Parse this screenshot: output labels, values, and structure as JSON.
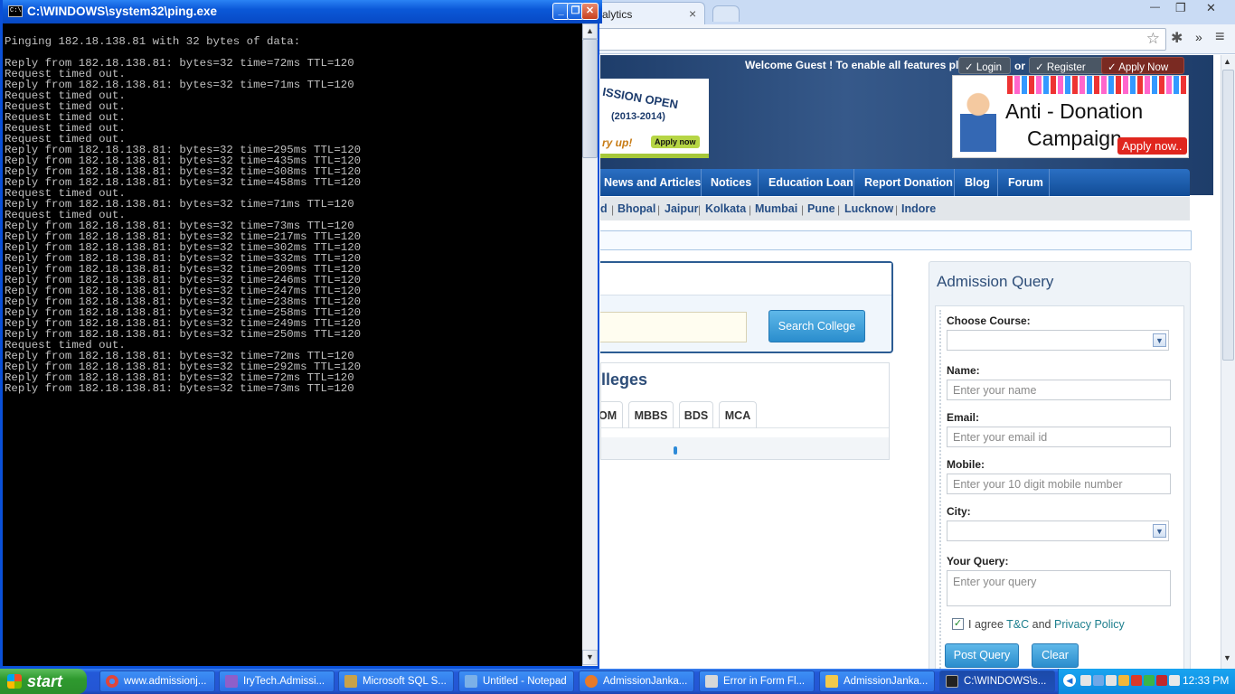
{
  "console": {
    "title": "C:\\WINDOWS\\system32\\ping.exe",
    "output": "Pinging 182.18.138.81 with 32 bytes of data:\n\nReply from 182.18.138.81: bytes=32 time=72ms TTL=120\nRequest timed out.\nReply from 182.18.138.81: bytes=32 time=71ms TTL=120\nRequest timed out.\nRequest timed out.\nRequest timed out.\nRequest timed out.\nRequest timed out.\nReply from 182.18.138.81: bytes=32 time=295ms TTL=120\nReply from 182.18.138.81: bytes=32 time=435ms TTL=120\nReply from 182.18.138.81: bytes=32 time=308ms TTL=120\nReply from 182.18.138.81: bytes=32 time=458ms TTL=120\nRequest timed out.\nReply from 182.18.138.81: bytes=32 time=71ms TTL=120\nRequest timed out.\nReply from 182.18.138.81: bytes=32 time=73ms TTL=120\nReply from 182.18.138.81: bytes=32 time=217ms TTL=120\nReply from 182.18.138.81: bytes=32 time=302ms TTL=120\nReply from 182.18.138.81: bytes=32 time=332ms TTL=120\nReply from 182.18.138.81: bytes=32 time=209ms TTL=120\nReply from 182.18.138.81: bytes=32 time=246ms TTL=120\nReply from 182.18.138.81: bytes=32 time=247ms TTL=120\nReply from 182.18.138.81: bytes=32 time=238ms TTL=120\nReply from 182.18.138.81: bytes=32 time=258ms TTL=120\nReply from 182.18.138.81: bytes=32 time=249ms TTL=120\nReply from 182.18.138.81: bytes=32 time=250ms TTL=120\nRequest timed out.\nReply from 182.18.138.81: bytes=32 time=72ms TTL=120\nReply from 182.18.138.81: bytes=32 time=292ms TTL=120\nReply from 182.18.138.81: bytes=32 time=72ms TTL=120\nReply from 182.18.138.81: bytes=32 time=73ms TTL=120",
    "icon": "console-icon",
    "buttons": {
      "minimize": "_",
      "maximize": "❐",
      "close": "✕"
    }
  },
  "browser": {
    "tab_label": "alytics",
    "tab_close": "×",
    "window_buttons": {
      "minimize": "—",
      "restore": "❐",
      "close": "✕"
    },
    "more": "»",
    "menu": "≡"
  },
  "site": {
    "welcome": "Welcome Guest ! To enable all features please",
    "login": "Login",
    "or": "or",
    "register": "Register",
    "apply_now": "Apply Now",
    "banner_left": {
      "line1": "ISSION OPEN",
      "line2": "(2013-2014)",
      "line3": "ry up!",
      "btn": "Apply now"
    },
    "banner_right": {
      "line1": "Anti - Donation",
      "line2": "Campaign",
      "btn": "Apply now.."
    },
    "nav": [
      "News and Articles",
      "Notices",
      "Education Loan",
      "Report Donation",
      "Blog",
      "Forum"
    ],
    "cities": [
      "d",
      "Bhopal",
      "Jaipur",
      "Kolkata",
      "Mumbai",
      "Pune",
      "Lucknow",
      "Indore"
    ],
    "search_button": "Search College",
    "colleges_heading": "lleges",
    "college_tabs": [
      "OM",
      "MBBS",
      "BDS",
      "MCA"
    ]
  },
  "admission_query": {
    "title": "Admission Query",
    "choose_course_label": "Choose Course:",
    "name_label": "Name:",
    "name_placeholder": "Enter your name",
    "email_label": "Email:",
    "email_placeholder": "Enter your email id",
    "mobile_label": "Mobile:",
    "mobile_placeholder": "Enter your 10 digit mobile number",
    "city_label": "City:",
    "query_label": "Your Query:",
    "query_placeholder": "Enter your query",
    "agree_text": "I agree",
    "tc": "T&C",
    "and": "and",
    "privacy": "Privacy Policy",
    "checkbox_checked": true,
    "post_button": "Post Query",
    "clear_button": "Clear"
  },
  "taskbar": {
    "start": "start",
    "tasks": [
      {
        "label": "www.admissionj...",
        "color": "#e0463a"
      },
      {
        "label": "IryTech.Admissi...",
        "color": "#8e5fc9"
      },
      {
        "label": "Microsoft SQL S...",
        "color": "#c9a24a"
      },
      {
        "label": "Untitled - Notepad",
        "color": "#7bb0e8"
      },
      {
        "label": "AdmissionJanka...",
        "color": "#e87a2a"
      },
      {
        "label": "Error in Form Fl...",
        "color": "#d8d8d8"
      },
      {
        "label": "AdmissionJanka...",
        "color": "#f2c94c"
      },
      {
        "label": "C:\\WINDOWS\\s...",
        "color": "#222222"
      }
    ],
    "clock": "12:33 PM"
  }
}
